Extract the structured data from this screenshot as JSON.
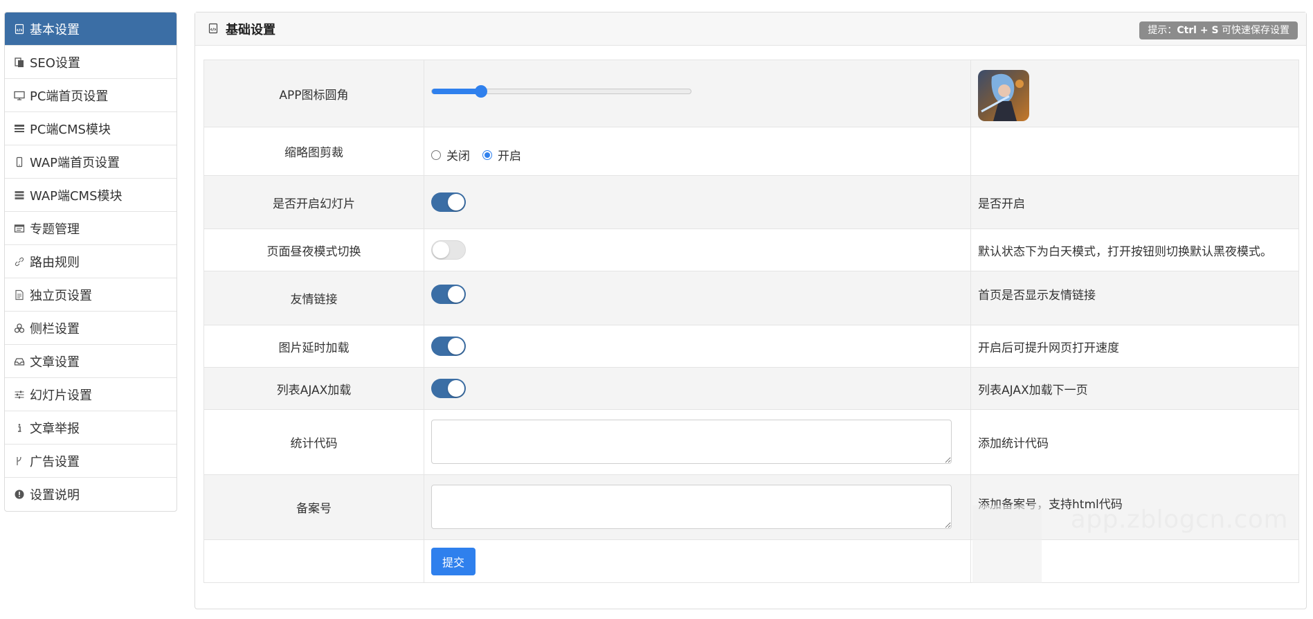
{
  "sidebar": {
    "items": [
      {
        "label": "基本设置",
        "icon": "settings-file-icon"
      },
      {
        "label": "SEO设置",
        "icon": "copy-icon"
      },
      {
        "label": "PC端首页设置",
        "icon": "monitor-icon"
      },
      {
        "label": "PC端CMS模块",
        "icon": "list-icon"
      },
      {
        "label": "WAP端首页设置",
        "icon": "mobile-icon"
      },
      {
        "label": "WAP端CMS模块",
        "icon": "server-icon"
      },
      {
        "label": "专题管理",
        "icon": "window-icon"
      },
      {
        "label": "路由规则",
        "icon": "link-icon"
      },
      {
        "label": "独立页设置",
        "icon": "document-icon"
      },
      {
        "label": "侧栏设置",
        "icon": "cubes-icon"
      },
      {
        "label": "文章设置",
        "icon": "inbox-icon"
      },
      {
        "label": "幻灯片设置",
        "icon": "sliders-icon"
      },
      {
        "label": "文章举报",
        "icon": "info-icon"
      },
      {
        "label": "广告设置",
        "icon": "branch-icon"
      },
      {
        "label": "设置说明",
        "icon": "exclamation-circle-icon"
      }
    ],
    "active_index": 0,
    "active_color": "#3b6ea5"
  },
  "panel": {
    "title": "基础设置",
    "hint_prefix": "提示：",
    "hint_keys": "Ctrl + S",
    "hint_suffix": " 可快速保存设置"
  },
  "rows": {
    "app_icon_radius": {
      "label": "APP图标圆角",
      "slider_value_fraction": 0.19
    },
    "thumbnail_crop": {
      "label": "缩略图剪裁",
      "option_off": "关闭",
      "option_on": "开启",
      "selected": "开启"
    },
    "slideshow": {
      "label": "是否开启幻灯片",
      "enabled": true,
      "note": "是否开启"
    },
    "day_night": {
      "label": "页面昼夜模式切换",
      "enabled": false,
      "note": "默认状态下为白天模式，打开按钮则切换默认黑夜模式。"
    },
    "friend_links": {
      "label": "友情链接",
      "enabled": true,
      "note": "首页是否显示友情链接"
    },
    "lazy_load": {
      "label": "图片延时加载",
      "enabled": true,
      "note": "开启后可提升网页打开速度"
    },
    "ajax_list": {
      "label": "列表AJAX加载",
      "enabled": true,
      "note": "列表AJAX加载下一页"
    },
    "stats_code": {
      "label": "统计代码",
      "value": "",
      "note": "添加统计代码"
    },
    "icp": {
      "label": "备案号",
      "value": "",
      "note": "添加备案号，支持html代码"
    }
  },
  "submit_label": "提交",
  "watermark": {
    "text": "app.zblogcn.com"
  },
  "colors": {
    "accent": "#2f80ed",
    "toggle_on": "#3b6ea5",
    "hint_bg": "#8c8c8c"
  }
}
